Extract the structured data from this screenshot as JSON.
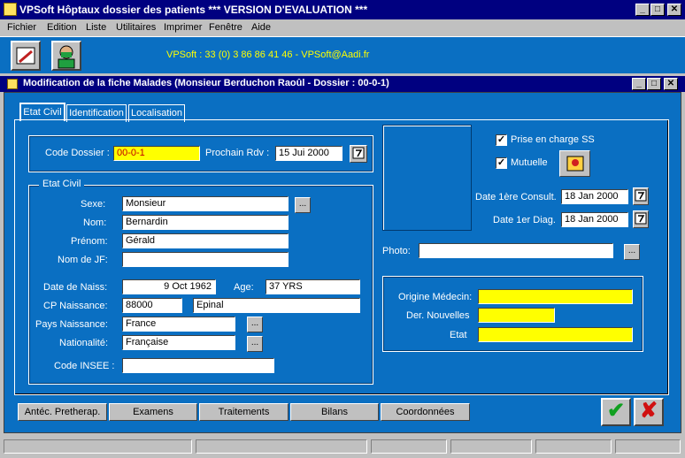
{
  "window": {
    "title": "VPSoft Hôptaux dossier des patients *** VERSION D'EVALUATION ***",
    "min": "_",
    "max": "□",
    "close": "✕"
  },
  "menu": [
    {
      "label": "Fichier"
    },
    {
      "label": "Edition"
    },
    {
      "label": "Liste"
    },
    {
      "label": "Utilitaires"
    },
    {
      "label": "Imprimer"
    },
    {
      "label": "Fenêtre"
    },
    {
      "label": "Aide"
    }
  ],
  "toolbar": {
    "info": "VPSoft : 33 (0) 3 86 86 41 46 - VPSoft@Aadi.fr"
  },
  "form": {
    "title": "Modification de la fiche Malades  (Monsieur Berduchon Raoûl - Dossier : 00-0-1)",
    "min": "_",
    "max": "□",
    "close": "✕"
  },
  "tabs": [
    {
      "label": "Etat Civil"
    },
    {
      "label": "Identification"
    },
    {
      "label": "Localisation"
    }
  ],
  "dossier": {
    "code_label": "Code Dossier :",
    "code_value": "00-0-1",
    "rdv_label": "Prochain Rdv :",
    "rdv_value": "15 Jui 2000"
  },
  "etat_civil": {
    "group_label": "Etat Civil",
    "sexe_label": "Sexe:",
    "sexe_value": "Monsieur",
    "nom_label": "Nom:",
    "nom_value": "Bernardin",
    "prenom_label": "Prénom:",
    "prenom_value": "Gérald",
    "nomjf_label": "Nom de JF:",
    "nomjf_value": "",
    "naiss_label": "Date de Naiss:",
    "naiss_value": "9 Oct 1962",
    "age_label": "Age:",
    "age_value": "37 YRS",
    "cp_label": "CP Naissance:",
    "cp_value": "88000",
    "ville_value": "Epinal",
    "pays_label": "Pays Naissance:",
    "pays_value": "France",
    "nat_label": "Nationalité:",
    "nat_value": "Française",
    "insee_label": "Code INSEE :",
    "insee_value": ""
  },
  "right": {
    "prise_label": "Prise en charge SS",
    "prise_checked": "✓",
    "mutuelle_label": "Mutuelle",
    "mutuelle_checked": "✓",
    "consult_label": "Date 1ère Consult.",
    "consult_value": "18 Jan 2000",
    "diag_label": "Date 1er Diag.",
    "diag_value": "18 Jan 2000",
    "photo_label": "Photo:",
    "photo_value": "",
    "origine_label": "Origine Médecin:",
    "origine_value": "",
    "dernouv_label": "Der. Nouvelles",
    "dernouv_value": "",
    "etat_label": "Etat",
    "etat_value": ""
  },
  "bottom_buttons": [
    "Antéc. Pretherap.",
    "Examens",
    "Traitements",
    "Bilans",
    "Coordonnées"
  ],
  "ok": "✔",
  "cancel": "✘",
  "ellipsis": "...",
  "colors": {
    "panel": "#0a6fc2",
    "title": "#000080",
    "highlight": "#ffff00"
  }
}
